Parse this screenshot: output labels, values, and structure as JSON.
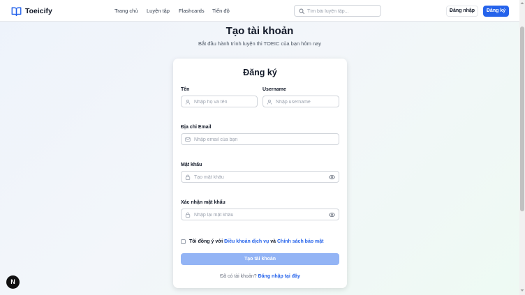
{
  "header": {
    "logo_text": "Toeicify",
    "nav": [
      "Trang chủ",
      "Luyện tập",
      "Flashcards",
      "Tiến độ"
    ],
    "search_placeholder": "Tìm bài luyện tập...",
    "login_label": "Đăng nhập",
    "register_label": "Đăng ký"
  },
  "page": {
    "title": "Tạo tài khoản",
    "subtitle": "Bắt đầu hành trình luyện thi TOEIC của bạn hôm nay"
  },
  "form": {
    "title": "Đăng ký",
    "name_label": "Tên",
    "name_placeholder": "Nhập họ và tên",
    "username_label": "Username",
    "username_placeholder": "Nhập username",
    "email_label": "Địa chỉ Email",
    "email_placeholder": "Nhập email của bạn",
    "password_label": "Mật khẩu",
    "password_placeholder": "Tạo mật khẩu",
    "confirm_label": "Xác nhận mật khẩu",
    "confirm_placeholder": "Nhập lại mật khẩu",
    "terms_prefix": "Tôi đồng ý với",
    "terms_link": "Điều khoản dịch vụ",
    "terms_and": "và",
    "privacy_link": "Chính sách bảo mật",
    "submit_label": "Tạo tài khoản",
    "have_account": "Đã có tài khoản?",
    "login_link": "Đăng nhập tại đây"
  },
  "badge": "N",
  "colors": {
    "primary": "#2563eb",
    "submit_disabled": "#93b4f5",
    "text": "#111827",
    "muted": "#6b7280"
  },
  "icons": [
    "book-open-icon",
    "search-icon",
    "user-icon",
    "mail-icon",
    "lock-icon",
    "eye-icon"
  ]
}
